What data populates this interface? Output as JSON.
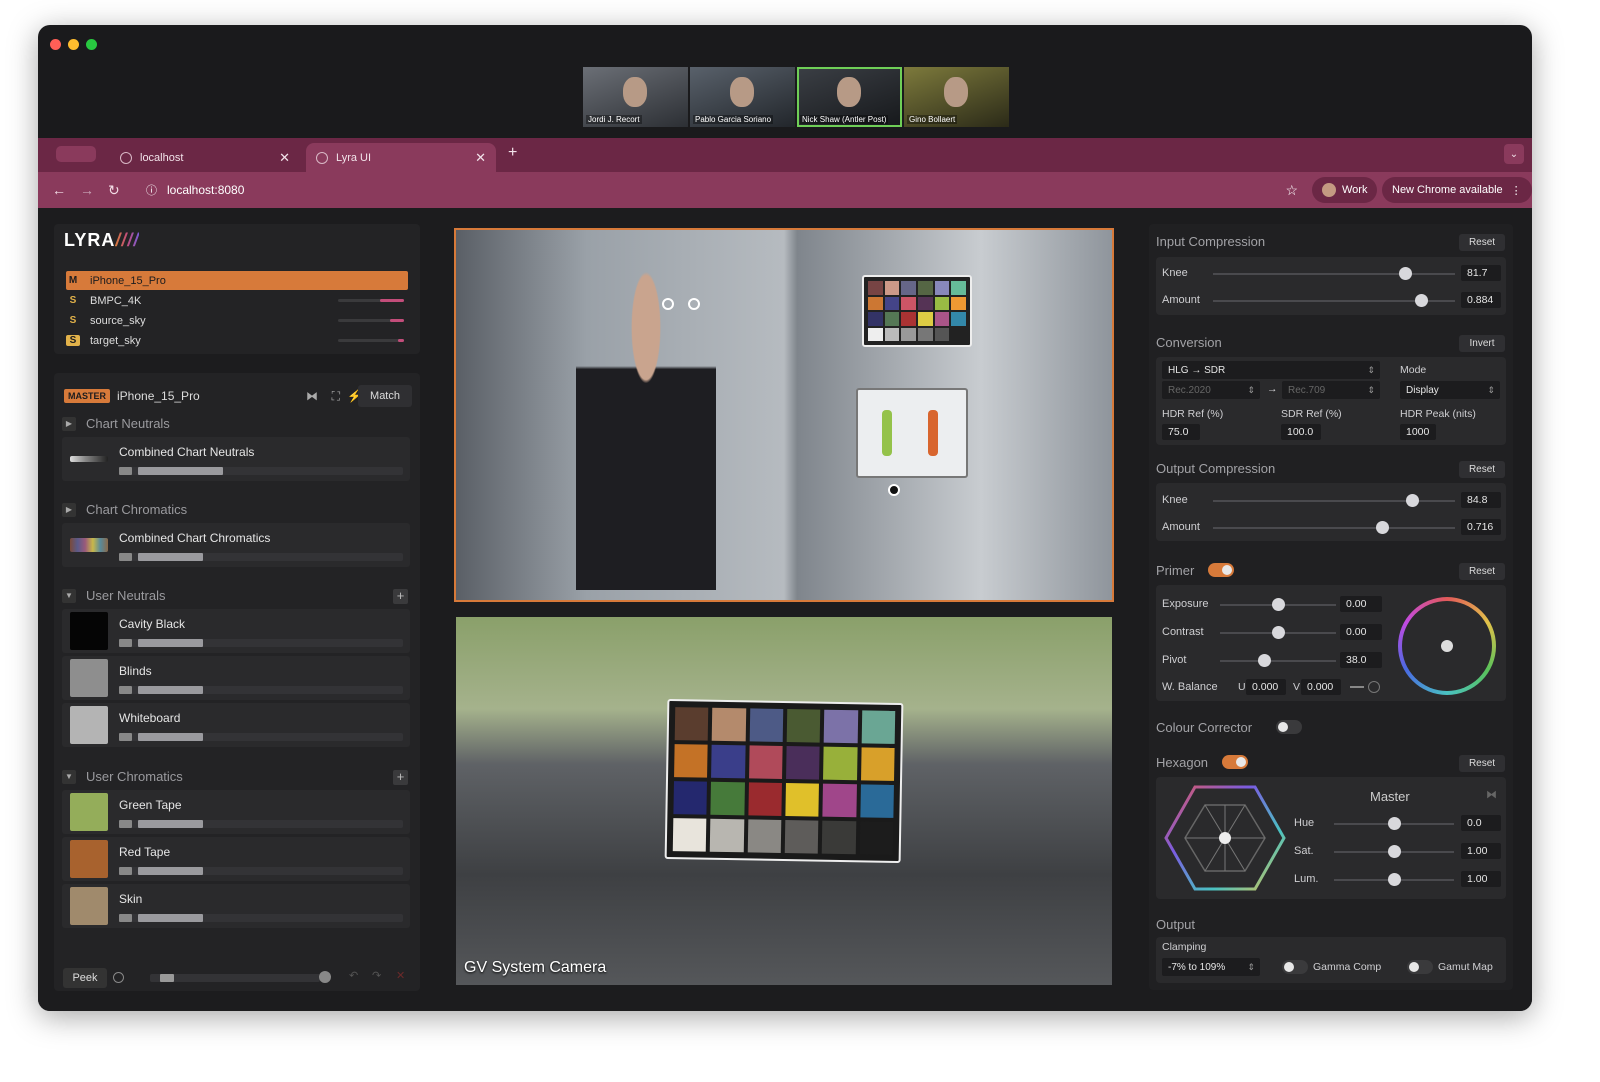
{
  "participants": [
    "Jordi J. Recort",
    "Pablo Garcia Soriano",
    "Nick Shaw (Antler Post)",
    "Gino Bollaert"
  ],
  "tabs": [
    {
      "label": "localhost"
    },
    {
      "label": "Lyra UI"
    }
  ],
  "address": "localhost:8080",
  "profile_label": "Work",
  "update_label": "New Chrome available",
  "logo": "LYRA",
  "sources": [
    {
      "badge": "M",
      "name": "iPhone_15_Pro"
    },
    {
      "badge": "S",
      "name": "BMPC_4K"
    },
    {
      "badge": "S",
      "name": "source_sky"
    },
    {
      "badge": "S",
      "name": "target_sky"
    }
  ],
  "master": {
    "badge": "MASTER",
    "name": "iPhone_15_Pro",
    "match_label": "Match"
  },
  "sections": {
    "chart_neutrals": "Chart Neutrals",
    "combined_neutrals": "Combined Chart Neutrals",
    "chart_chromatics": "Chart Chromatics",
    "combined_chromatics": "Combined Chart Chromatics",
    "user_neutrals": "User Neutrals",
    "user_chromatics": "User Chromatics"
  },
  "user_neutrals": [
    {
      "name": "Cavity Black",
      "color": "#050505"
    },
    {
      "name": "Blinds",
      "color": "#8e8e8e"
    },
    {
      "name": "Whiteboard",
      "color": "#b4b4b4"
    }
  ],
  "user_chromatics": [
    {
      "name": "Green Tape",
      "color": "#94ad5a"
    },
    {
      "name": "Red Tape",
      "color": "#a8622e"
    },
    {
      "name": "Skin",
      "color": "#a08a6c"
    }
  ],
  "footer": {
    "peek_label": "Peek"
  },
  "camera_label": "GV System Camera",
  "right": {
    "input_compression": {
      "title": "Input Compression",
      "reset": "Reset",
      "knee_label": "Knee",
      "knee": "81.7",
      "amount_label": "Amount",
      "amount": "0.884"
    },
    "conversion": {
      "title": "Conversion",
      "invert": "Invert",
      "transform": "HLG → SDR",
      "mode_label": "Mode",
      "from": "Rec.2020",
      "arrow": "→",
      "to": "Rec.709",
      "mode": "Display",
      "hdr_ref_label": "HDR Ref (%)",
      "hdr_ref": "75.0",
      "sdr_ref_label": "SDR Ref (%)",
      "sdr_ref": "100.0",
      "hdr_peak_label": "HDR Peak (nits)",
      "hdr_peak": "1000"
    },
    "output_compression": {
      "title": "Output Compression",
      "reset": "Reset",
      "knee_label": "Knee",
      "knee": "84.8",
      "amount_label": "Amount",
      "amount": "0.716"
    },
    "primer": {
      "title": "Primer",
      "reset": "Reset",
      "exposure_label": "Exposure",
      "exposure": "0.00",
      "contrast_label": "Contrast",
      "contrast": "0.00",
      "pivot_label": "Pivot",
      "pivot": "38.0",
      "wb_label": "W. Balance",
      "u_label": "U",
      "u": "0.000",
      "v_label": "V",
      "v": "0.000"
    },
    "colour_corrector": {
      "title": "Colour Corrector"
    },
    "hexagon": {
      "title": "Hexagon",
      "reset": "Reset",
      "master_label": "Master",
      "hue_label": "Hue",
      "hue": "0.0",
      "sat_label": "Sat.",
      "sat": "1.00",
      "lum_label": "Lum.",
      "lum": "1.00"
    },
    "output": {
      "title": "Output",
      "clamping_label": "Clamping",
      "clamping": "-7% to 109%",
      "gamma_label": "Gamma Comp",
      "gamut_label": "Gamut Map"
    }
  }
}
